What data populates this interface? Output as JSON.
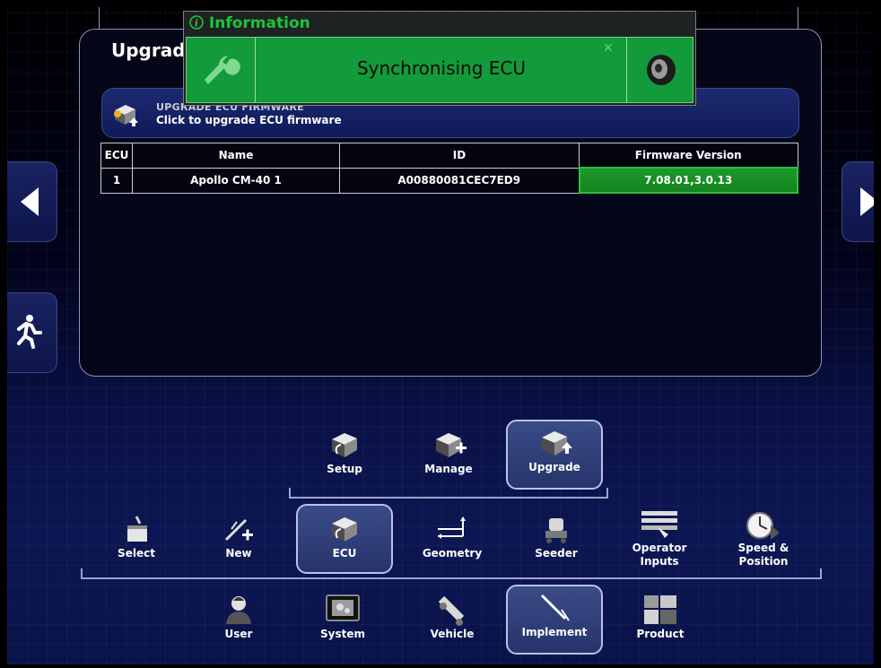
{
  "panel": {
    "title": "Upgrad"
  },
  "banner": {
    "title": "UPGRADE ECU FIRMWARE",
    "subtitle": "Click to upgrade ECU firmware"
  },
  "table": {
    "headers": [
      "ECU",
      "Name",
      "ID",
      "Firmware Version"
    ],
    "rows": [
      {
        "ecu": "1",
        "name": "Apollo CM-40 1",
        "id": "A00880081CEC7ED9",
        "firmware": "7.08.01,3.0.13"
      }
    ]
  },
  "info": {
    "title": "Information",
    "message": "Synchronising ECU",
    "icons": [
      "wrench-icon",
      "close-icon",
      "speaker-icon"
    ]
  },
  "side_buttons": [
    "left-arrow-icon",
    "exit-icon",
    "right-arrow-icon"
  ],
  "nav": {
    "top": [
      {
        "label": "Setup",
        "icon": "ecu-setup-icon"
      },
      {
        "label": "Manage",
        "icon": "ecu-manage-icon"
      },
      {
        "label": "Upgrade",
        "icon": "ecu-upgrade-icon",
        "selected": true
      }
    ],
    "middle": [
      {
        "label": "Select",
        "icon": "select-icon"
      },
      {
        "label": "New",
        "icon": "new-implement-icon"
      },
      {
        "label": "ECU",
        "icon": "ecu-icon",
        "selected": true
      },
      {
        "label": "Geometry",
        "icon": "geometry-icon"
      },
      {
        "label": "Seeder",
        "icon": "seeder-icon"
      },
      {
        "label": "Operator\nInputs",
        "label_1": "Operator",
        "label_2": "Inputs",
        "icon": "operator-inputs-icon"
      },
      {
        "label": "Speed &\nPosition",
        "label_1": "Speed &",
        "label_2": "Position",
        "icon": "speed-position-icon"
      }
    ],
    "bottom": [
      {
        "label": "User",
        "icon": "user-icon"
      },
      {
        "label": "System",
        "icon": "system-icon"
      },
      {
        "label": "Vehicle",
        "icon": "vehicle-icon"
      },
      {
        "label": "Implement",
        "icon": "implement-icon",
        "selected": true
      },
      {
        "label": "Product",
        "icon": "product-icon"
      }
    ]
  },
  "colors": {
    "accent_green": "#139a3a",
    "firmware_cell": "#1c9a2c",
    "info_title": "#1ec43a"
  }
}
